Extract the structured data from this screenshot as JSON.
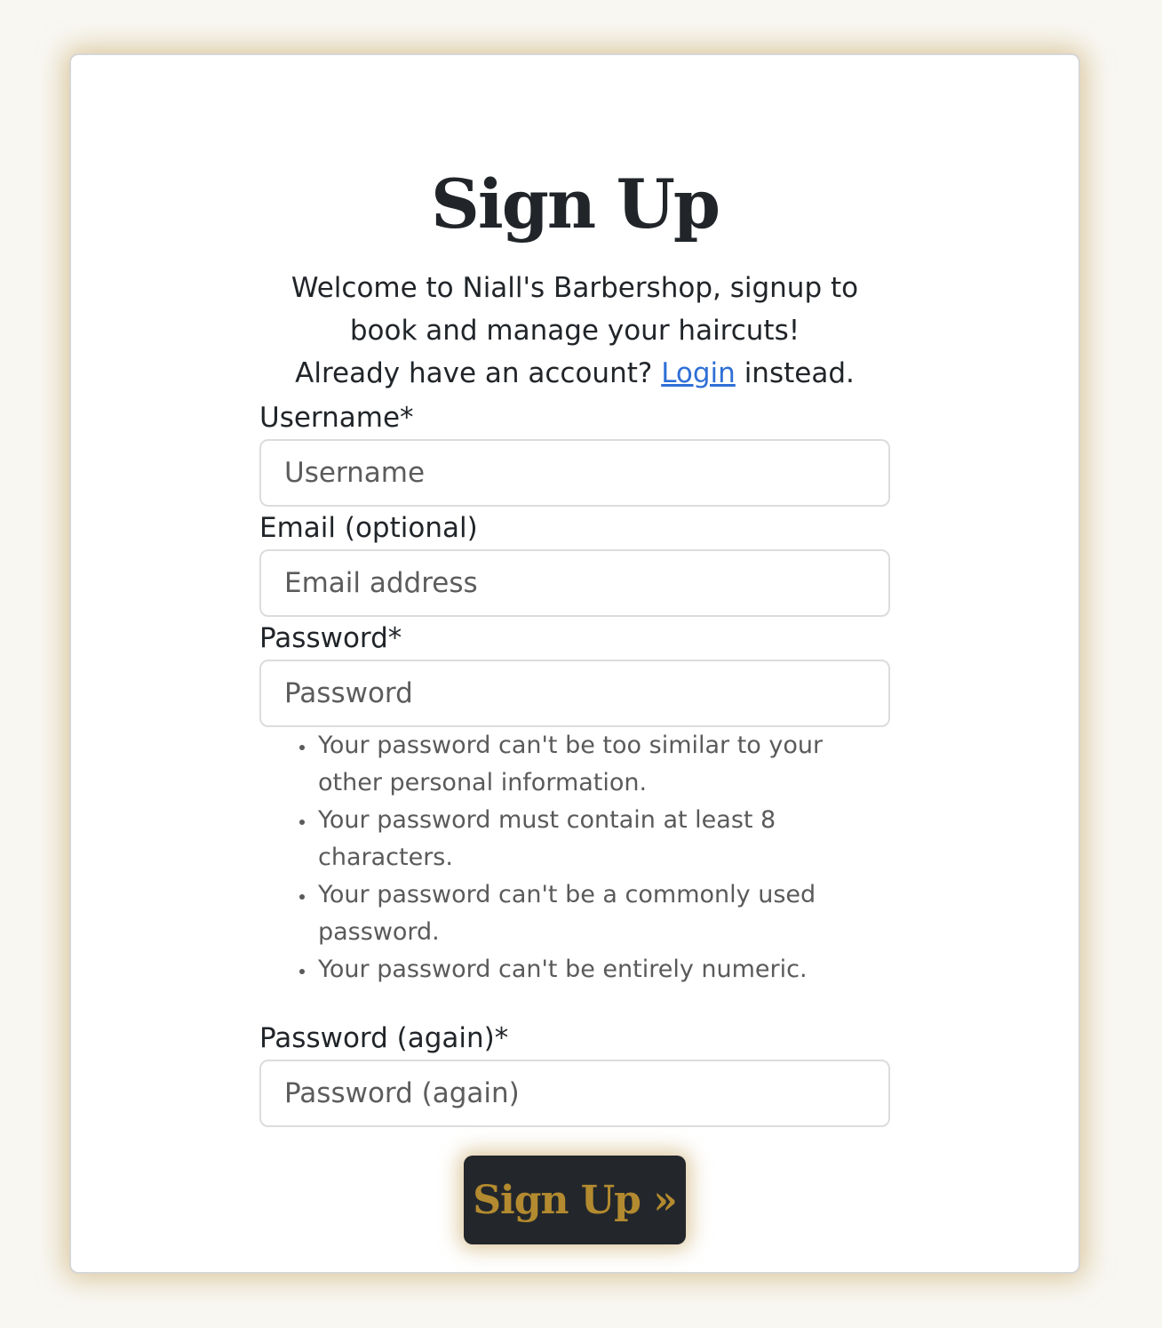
{
  "page": {
    "title": "Sign Up",
    "intro_line1": "Welcome to Niall's Barbershop, signup to",
    "intro_line2": "book and manage your haircuts!",
    "intro_line3_prefix": "Already have an account?",
    "login_link": "Login",
    "intro_line3_suffix": "instead."
  },
  "form": {
    "username_label": "Username*",
    "username_placeholder": "Username",
    "username_value": "",
    "email_label": "Email (optional)",
    "email_placeholder": "Email address",
    "email_value": "",
    "password_label": "Password*",
    "password_placeholder": "Password",
    "password_value": "",
    "password_help": [
      "Your password can't be too similar to your other personal information.",
      "Your password must contain at least 8 characters.",
      "Your password can't be a commonly used password.",
      "Your password can't be entirely numeric."
    ],
    "password2_label": "Password (again)*",
    "password2_placeholder": "Password (again)",
    "password2_value": "",
    "submit_label": "Sign Up »"
  },
  "colors": {
    "background": "#f8f7f2",
    "button_bg": "#23272b",
    "button_text": "#b38a2f",
    "link": "#2f6fd6",
    "card_glow": "#c4a05a"
  }
}
